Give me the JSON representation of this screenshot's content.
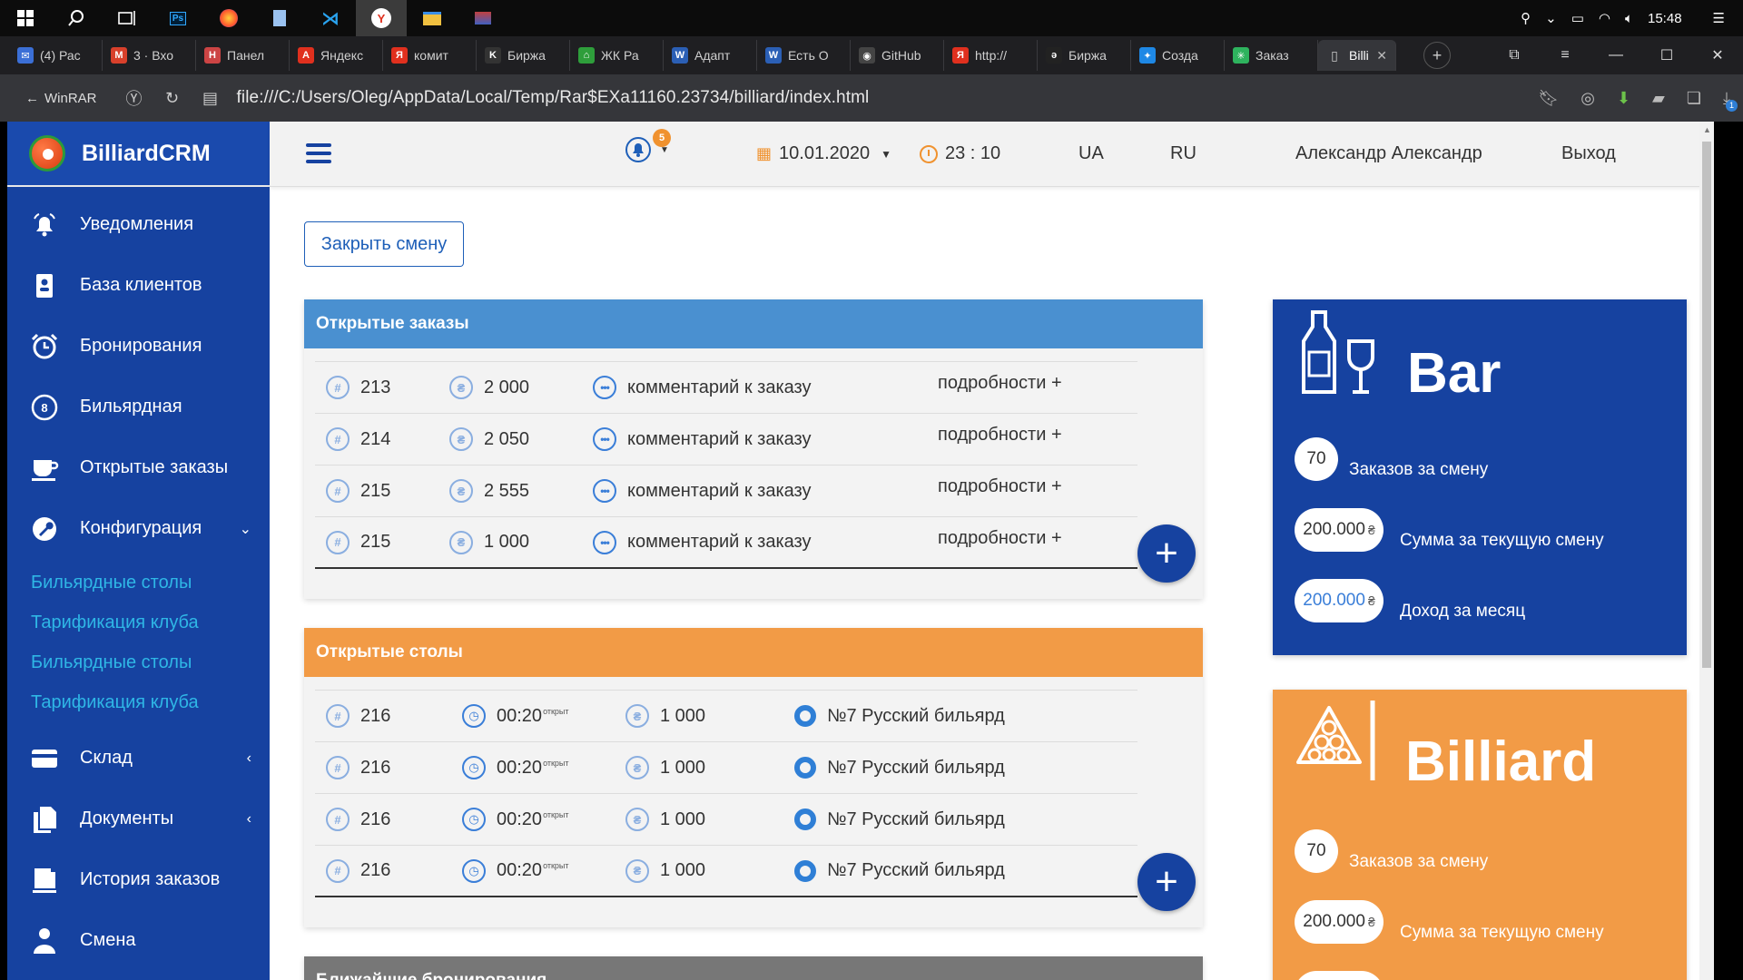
{
  "taskbar": {
    "icons": [
      "windows-start",
      "search",
      "task-view",
      "photoshop",
      "firefox",
      "document",
      "vscode",
      "yandex-browser",
      "file-explorer",
      "media"
    ],
    "clock": "15:48"
  },
  "browser": {
    "tabs": [
      {
        "label": "(4) Рас",
        "color": "#3b6fd6",
        "glyph": "✉"
      },
      {
        "label": "3 · Вхо",
        "color": "#d8402b",
        "glyph": "M"
      },
      {
        "label": "Панел",
        "color": "#cc4444",
        "glyph": "H"
      },
      {
        "label": "Яндекс",
        "color": "#e0301e",
        "glyph": "A"
      },
      {
        "label": "комит",
        "color": "#e0301e",
        "glyph": "Я"
      },
      {
        "label": "Биржа",
        "color": "#333333",
        "glyph": "K"
      },
      {
        "label": "ЖК Ра",
        "color": "#2e9e3b",
        "glyph": "⌂"
      },
      {
        "label": "Адапт",
        "color": "#2b5fb5",
        "glyph": "W"
      },
      {
        "label": "Есть О",
        "color": "#2b5fb5",
        "glyph": "W"
      },
      {
        "label": "GitHub",
        "color": "#444444",
        "glyph": "◉"
      },
      {
        "label": "http://",
        "color": "#e0301e",
        "glyph": "Я"
      },
      {
        "label": "Биржа",
        "color": "#222222",
        "glyph": "ə"
      },
      {
        "label": "Созда",
        "color": "#1e88e5",
        "glyph": "✦"
      },
      {
        "label": "Заказ",
        "color": "#2eb35e",
        "glyph": "✳"
      }
    ],
    "active_tab": {
      "label": "Billi",
      "glyph": "▯"
    },
    "back_label": "WinRAR",
    "url": "file:///C:/Users/Oleg/AppData/Local/Temp/Rar$EXa11160.23734/billiard/index.html",
    "downloads_badge": "1"
  },
  "app": {
    "brand": "BilliardCRM",
    "nav": [
      {
        "label": "Уведомления",
        "icon": "bell-icon"
      },
      {
        "label": "База клиентов",
        "icon": "contacts-icon"
      },
      {
        "label": "Бронирования",
        "icon": "alarm-clock-icon"
      },
      {
        "label": "Бильярдная",
        "icon": "billiard-ball-icon"
      },
      {
        "label": "Открытые заказы",
        "icon": "coffee-cup-icon"
      },
      {
        "label": "Конфигурация",
        "icon": "wrench-icon"
      }
    ],
    "sub_nav": [
      "Бильярдные столы",
      "Тарификация клуба",
      "Бильярдные столы",
      "Тарификация клуба"
    ],
    "nav_bottom": [
      {
        "label": "Склад",
        "icon": "warehouse-icon"
      },
      {
        "label": "Документы",
        "icon": "documents-icon"
      },
      {
        "label": "История заказов",
        "icon": "history-icon"
      },
      {
        "label": "Смена",
        "icon": "user-icon"
      }
    ],
    "header": {
      "notifications_count": "5",
      "date": "10.01.2020",
      "time": "23 : 10",
      "lang_ua": "UA",
      "lang_ru": "RU",
      "user": "Александр Александр",
      "logout": "Выход"
    },
    "close_shift": "Закрыть смену",
    "open_orders": {
      "title": "Открытые заказы",
      "color": "#4a90d0",
      "rows": [
        {
          "id": "213",
          "amount": "2 000",
          "comment": "комментарий к заказу",
          "details": "подробности +"
        },
        {
          "id": "214",
          "amount": "2 050",
          "comment": "комментарий к заказу",
          "details": "подробности +"
        },
        {
          "id": "215",
          "amount": "2 555",
          "comment": "комментарий к заказу",
          "details": "подробности +"
        },
        {
          "id": "215",
          "amount": "1 000",
          "comment": "комментарий к заказу",
          "details": "подробности +"
        }
      ]
    },
    "open_tables": {
      "title": "Открытые столы",
      "color": "#f29b46",
      "rows": [
        {
          "id": "216",
          "time": "00:20",
          "time_note": "открыт",
          "amount": "1 000",
          "table": "№7 Русский бильярд"
        },
        {
          "id": "216",
          "time": "00:20",
          "time_note": "открыт",
          "amount": "1 000",
          "table": "№7 Русский бильярд"
        },
        {
          "id": "216",
          "time": "00:20",
          "time_note": "открыт",
          "amount": "1 000",
          "table": "№7 Русский бильярд"
        },
        {
          "id": "216",
          "time": "00:20",
          "time_note": "открыт",
          "amount": "1 000",
          "table": "№7 Русский бильярд"
        }
      ]
    },
    "next_bookings": {
      "title": "Ближайшие бронирования",
      "color": "#777777"
    },
    "bar_card": {
      "title": "Bar",
      "color": "#1642a0",
      "orders_count": "70",
      "orders_label": "Заказов за смену",
      "shift_sum": "200.000",
      "shift_sum_label": "Сумма за текущую смену",
      "month_income": "200.000",
      "month_income_label": "Доход за месяц",
      "currency": "₴"
    },
    "billiard_card": {
      "title": "Billiard",
      "color": "#f29b46",
      "orders_count": "70",
      "orders_label": "Заказов за смену",
      "shift_sum": "200.000",
      "shift_sum_label": "Сумма за текущую смену",
      "currency": "₴"
    }
  }
}
